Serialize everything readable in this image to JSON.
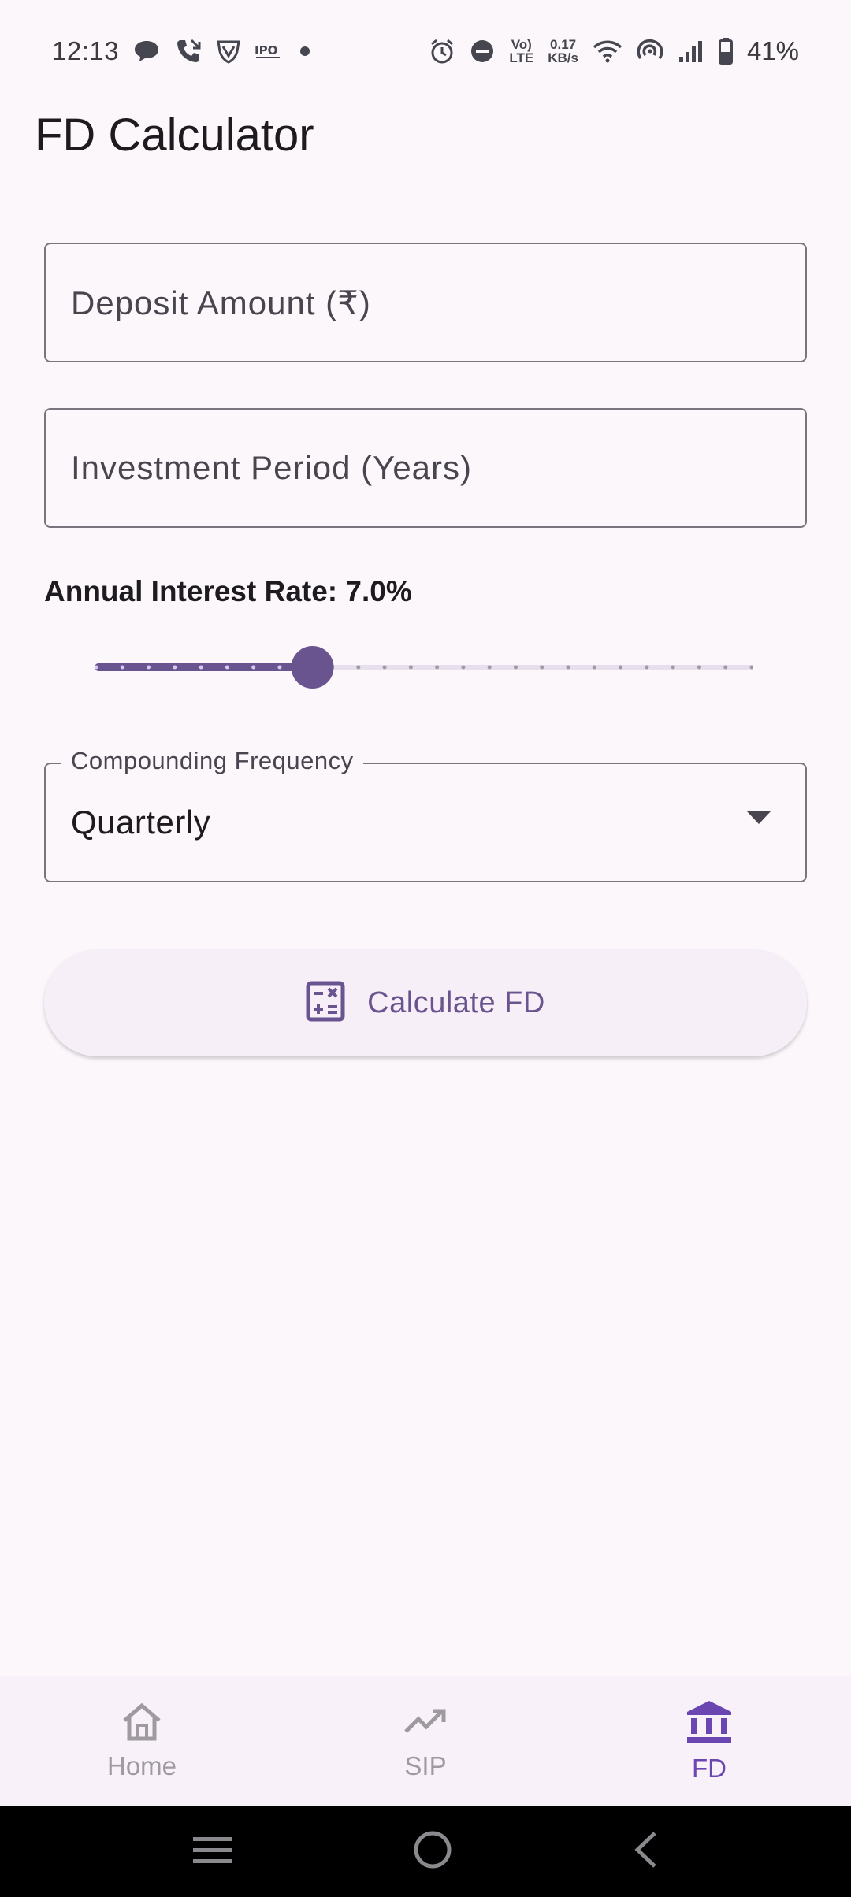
{
  "status_bar": {
    "time": "12:13",
    "network_speed_value": "0.17",
    "network_speed_unit": "KB/s",
    "volte_top": "Vo)",
    "volte_bottom": "LTE",
    "battery_percent": "41%"
  },
  "page": {
    "title": "FD Calculator"
  },
  "form": {
    "deposit_placeholder": "Deposit Amount (₹)",
    "period_placeholder": "Investment Period (Years)",
    "rate_label": "Annual Interest Rate: 7.0%",
    "rate_slider": {
      "value": 7.0,
      "min": 0,
      "max": 25,
      "fraction": 0.33,
      "divisions": 25
    },
    "compounding_label": "Compounding Frequency",
    "compounding_value": "Quarterly",
    "calculate_label": "Calculate FD"
  },
  "bottom_nav": {
    "items": [
      {
        "label": "Home",
        "icon": "home-icon",
        "active": false
      },
      {
        "label": "SIP",
        "icon": "trending-up-icon",
        "active": false
      },
      {
        "label": "FD",
        "icon": "bank-icon",
        "active": true
      }
    ]
  },
  "colors": {
    "background": "#fcf7fb",
    "primary": "#6a548f",
    "active_nav": "#6a46b0",
    "inactive_nav": "#9e9a9f",
    "outline": "#79747e"
  }
}
